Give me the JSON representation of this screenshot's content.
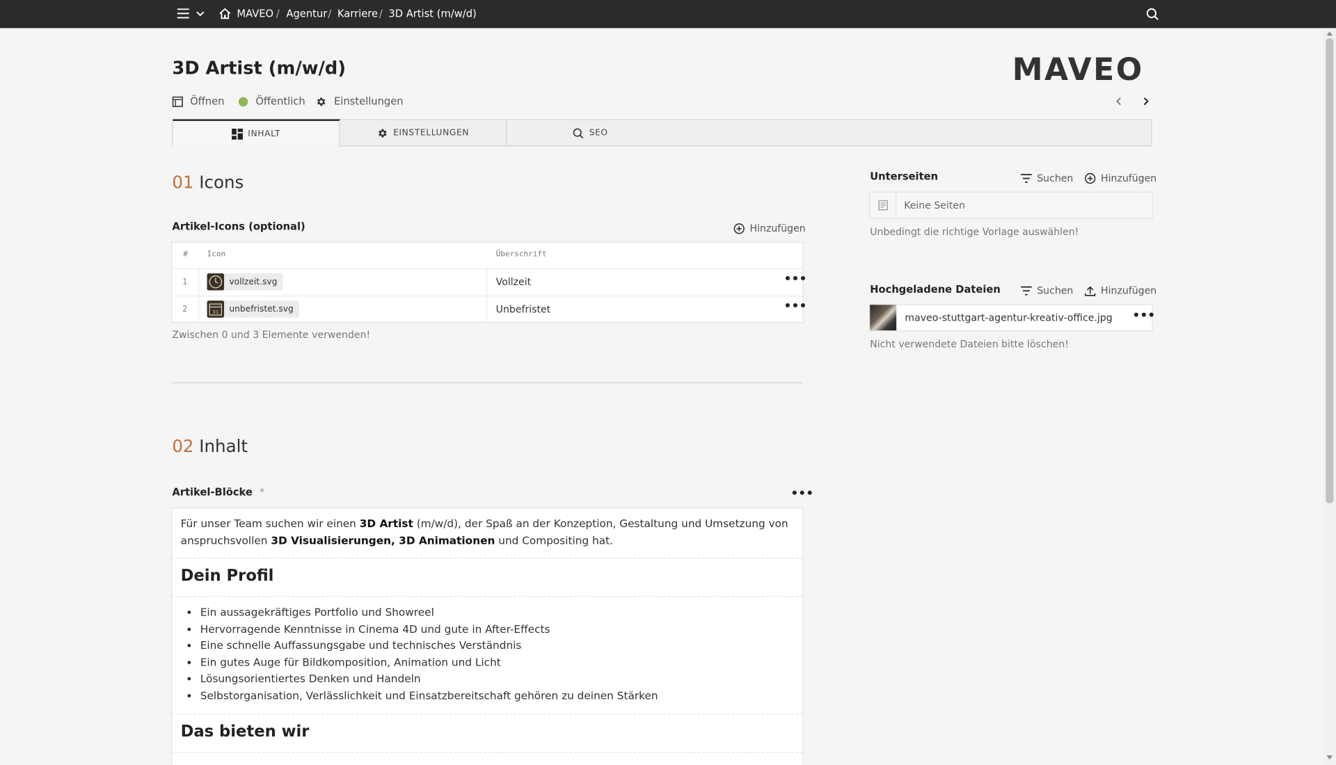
{
  "topbar": {
    "breadcrumb": [
      "MAVEO",
      "Agentur",
      "Karriere",
      "3D Artist (m/w/d)"
    ]
  },
  "page": {
    "title": "3D Artist (m/w/d)",
    "logo": "MAVEO",
    "meta": {
      "open_label": "Öffnen",
      "status_label": "Öffentlich",
      "status_color": "#8cb85c",
      "settings_label": "Einstellungen"
    }
  },
  "tabs": [
    {
      "label": "INHALT",
      "icon": "grid-icon",
      "active": true
    },
    {
      "label": "EINSTELLUNGEN",
      "icon": "gear-icon",
      "active": false
    },
    {
      "label": "SEO",
      "icon": "search-icon",
      "active": false
    }
  ],
  "section1": {
    "number": "01",
    "title": "Icons",
    "field_label": "Artikel-Icons (optional)",
    "add_label": "Hinzufügen",
    "columns": [
      "#",
      "Icon",
      "Überschrift"
    ],
    "rows": [
      {
        "num": "1",
        "file": "vollzeit.svg",
        "heading": "Vollzeit"
      },
      {
        "num": "2",
        "file": "unbefristet.svg",
        "heading": "Unbefristet"
      }
    ],
    "hint": "Zwischen 0 und 3 Elemente verwenden!"
  },
  "section2": {
    "number": "02",
    "title": "Inhalt",
    "field_label": "Artikel-Blöcke",
    "required_mark": "*",
    "intro": {
      "t1": "Für unser Team suchen wir einen ",
      "b1": "3D Artist",
      "t2": " (m/w/d), der Spaß an der Konzeption, Gestaltung und Umsetzung von anspruchsvollen ",
      "b2": "3D Visualisierungen, 3D Animationen",
      "t3": " und Compositing hat."
    },
    "heading_profile": "Dein Profil",
    "profile_items": [
      "Ein aussagekräftiges Portfolio und Showreel",
      "Hervorragende Kenntnisse in Cinema 4D und gute in After-Effects",
      "Eine schnelle Auffassungsgabe und technisches Verständnis",
      "Ein gutes Auge für Bildkomposition, Animation und Licht",
      "Lösungsorientiertes Denken und Handeln",
      "Selbstorganisation, Verlässlichkeit und Einsatzbereitschaft gehören zu deinen Stärken"
    ],
    "heading_offer": "Das bieten wir"
  },
  "subpages": {
    "title": "Unterseiten",
    "search_label": "Suchen",
    "add_label": "Hinzufügen",
    "empty_label": "Keine Seiten",
    "hint": "Unbedingt die richtige Vorlage auswählen!"
  },
  "uploads": {
    "title": "Hochgeladene Dateien",
    "search_label": "Suchen",
    "add_label": "Hinzufügen",
    "files": [
      "maveo-stuttgart-agentur-kreativ-office.jpg"
    ],
    "hint": "Nicht verwendete Dateien bitte löschen!"
  }
}
